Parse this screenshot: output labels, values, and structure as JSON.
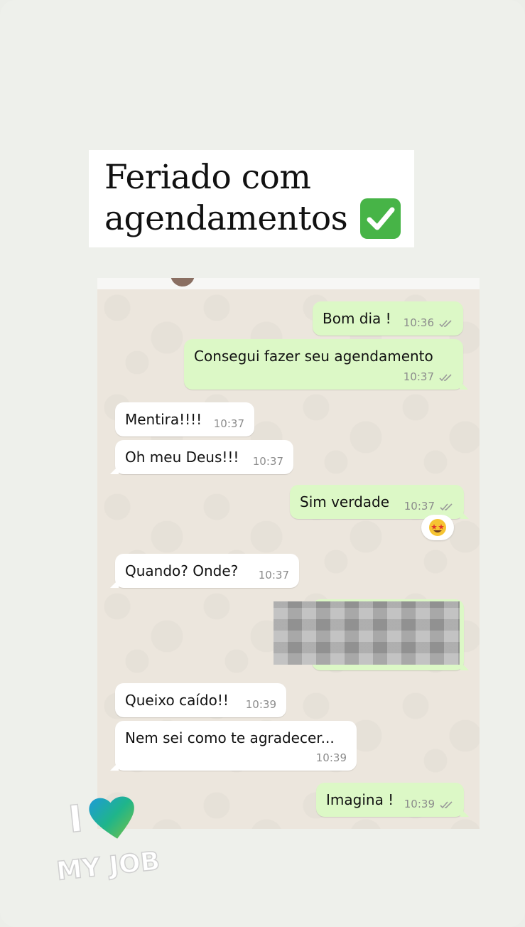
{
  "story": {
    "headline": "Feriado com\nagendamentos",
    "headline_icon": "check-mark-button-icon"
  },
  "messages": [
    {
      "direction": "out",
      "text": "Bom dia !",
      "time": "10:36",
      "status": "read"
    },
    {
      "direction": "out",
      "text": "Consegui fazer seu agendamento",
      "time": "10:37",
      "status": "read"
    },
    {
      "direction": "in",
      "text": "Mentira!!!!",
      "time": "10:37"
    },
    {
      "direction": "in",
      "text": "Oh meu Deus!!!",
      "time": "10:37"
    },
    {
      "direction": "out",
      "text": "Sim verdade",
      "time": "10:37",
      "status": "read",
      "reaction": "star-struck-emoji-icon"
    },
    {
      "direction": "in",
      "text": "Quando? Onde?",
      "time": "10:37"
    },
    {
      "direction": "out",
      "type": "image",
      "blurred": true
    },
    {
      "direction": "in",
      "text": "Queixo caído!!",
      "time": "10:39"
    },
    {
      "direction": "in",
      "text": "Nem sei como te agradecer...",
      "time": "10:39"
    },
    {
      "direction": "out",
      "text": "Imagina !",
      "time": "10:39",
      "status": "read"
    }
  ],
  "sticker": {
    "text_top": "I",
    "text_bottom": "MY JOB",
    "icon": "green-heart-icon"
  },
  "colors": {
    "outgoing_bubble": "#dcf8c6",
    "incoming_bubble": "#ffffff",
    "chat_background": "#ece6dd",
    "check_green": "#47b447"
  }
}
